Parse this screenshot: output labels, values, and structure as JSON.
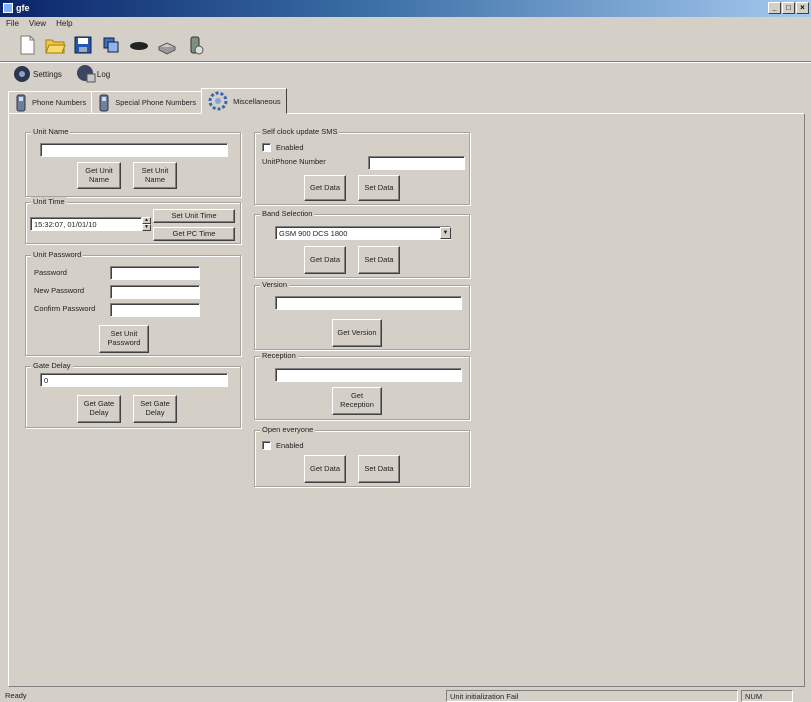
{
  "window": {
    "title": "gfe",
    "minimize": "_",
    "maximize": "□",
    "close": "×"
  },
  "menu": [
    {
      "label": "File"
    },
    {
      "label": "View"
    },
    {
      "label": "Help"
    }
  ],
  "toolbar": [
    {
      "icon": "new-file-icon"
    },
    {
      "icon": "open-folder-icon"
    },
    {
      "icon": "save-icon"
    },
    {
      "icon": "copy-icon"
    },
    {
      "icon": "disconnect-icon"
    },
    {
      "icon": "modem-icon"
    },
    {
      "icon": "phone-wizard-icon"
    }
  ],
  "view_buttons": {
    "settings": "Settings",
    "log": "Log"
  },
  "tabs": [
    {
      "label": "Phone Numbers",
      "icon": "phone-icon"
    },
    {
      "label": "Special Phone Numbers",
      "icon": "phone-icon"
    },
    {
      "label": "Miscellaneous",
      "icon": "gears-icon",
      "active": true
    }
  ],
  "unit_name": {
    "title": "Unit Name",
    "value": "",
    "get_button": "Get Unit\nName",
    "set_button": "Set Unit\nName"
  },
  "unit_time": {
    "title": "Unit Time",
    "value": "15:32:07, 01/01/10",
    "set_button": "Set Unit Time",
    "get_pc_button": "Get PC Time"
  },
  "unit_password": {
    "title": "Unit Password",
    "password_label": "Password",
    "new_password_label": "New Password",
    "confirm_label": "Confirm Password",
    "set_button": "Set Unit\nPassword"
  },
  "gate_delay": {
    "title": "Gate Delay",
    "value": "0",
    "get_button": "Get Gate\nDelay",
    "set_button": "Set Gate\nDelay"
  },
  "self_clock": {
    "title": "Self clock update SMS",
    "enabled_label": "Enabled",
    "phone_label": "UnitPhone Number",
    "phone_value": "",
    "get_button": "Get Data",
    "set_button": "Set Data"
  },
  "band": {
    "title": "Band Selection",
    "selected": "GSM 900 DCS 1800",
    "arrow": "▼",
    "get_button": "Get Data",
    "set_button": "Set Data"
  },
  "version": {
    "title": "Version",
    "value": "",
    "get_button": "Get Version"
  },
  "reception": {
    "title": "Reception",
    "value": "",
    "get_button": "Get\nReception"
  },
  "open_everyone": {
    "title": "Open everyone",
    "enabled_label": "Enabled",
    "get_button": "Get Data",
    "set_button": "Set Data"
  },
  "status": {
    "left": "Ready",
    "middle": "Unit initialization Fail",
    "right": "NUM"
  }
}
